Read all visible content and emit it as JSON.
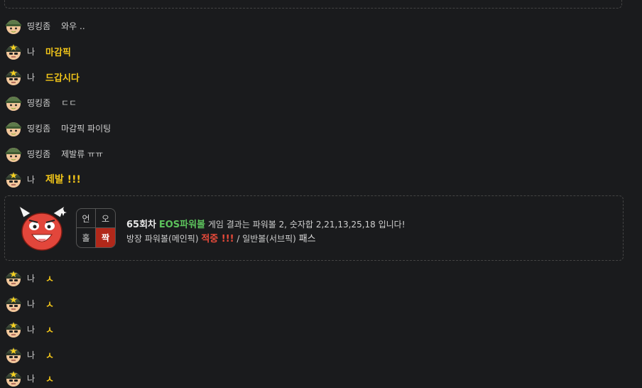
{
  "colors": {
    "background": "#1a1b1d",
    "my_text": "#f0c419",
    "game_name": "#5cc25c",
    "hit": "#e84a3a",
    "active_cell": "#b1281a"
  },
  "messages": [
    {
      "user": "띵킹좀",
      "text": "와우 ..",
      "avatar": "green-helmet-soldier-icon",
      "mine": false
    },
    {
      "user": "나",
      "text": "마감픽",
      "avatar": "star-helmet-soldier-icon",
      "mine": true
    },
    {
      "user": "나",
      "text": "드갑시다",
      "avatar": "star-helmet-soldier-icon",
      "mine": true
    },
    {
      "user": "띵킹좀",
      "text": "ㄷㄷ",
      "avatar": "green-helmet-soldier-icon",
      "mine": false
    },
    {
      "user": "띵킹좀",
      "text": "마감픽 파이팅",
      "avatar": "green-helmet-soldier-icon",
      "mine": false
    },
    {
      "user": "띵킹좀",
      "text": "제발류 ㅠㅠ",
      "avatar": "green-helmet-soldier-icon",
      "mine": false
    },
    {
      "user": "나",
      "text": "제발 !!!",
      "avatar": "star-helmet-soldier-icon",
      "mine": true
    },
    {
      "user": "나",
      "text": "ㅅ",
      "avatar": "star-helmet-soldier-icon",
      "mine": true
    },
    {
      "user": "나",
      "text": "ㅅ",
      "avatar": "star-helmet-soldier-icon",
      "mine": true
    },
    {
      "user": "나",
      "text": "ㅅ",
      "avatar": "star-helmet-soldier-icon",
      "mine": true
    },
    {
      "user": "나",
      "text": "ㅅ",
      "avatar": "star-helmet-soldier-icon",
      "mine": true
    },
    {
      "user": "나",
      "text": "ㅅ",
      "avatar": "star-helmet-soldier-icon",
      "mine": true
    }
  ],
  "system": {
    "icon": "red-devil-mascot-icon",
    "grid": {
      "tl": "언",
      "tr": "오",
      "bl": "홀",
      "br": "짝",
      "active": "br"
    },
    "round": "65회차",
    "game": "EOS파워볼",
    "result_text": "게임 결과는 파워볼 2, 숫자합 2,21,13,25,18 입니다!",
    "line2_prefix": "방장 파워볼(메인픽)",
    "hit_label": "적중 !!!",
    "line2_middle": "/ 일반볼(서브픽)",
    "pass_label": "패스"
  }
}
